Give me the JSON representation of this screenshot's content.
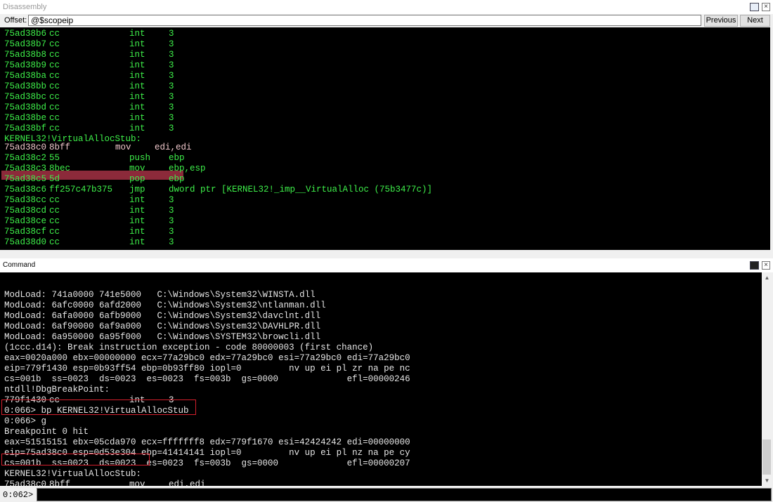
{
  "disassembly": {
    "title": "Disassembly",
    "offset_label": "Offset:",
    "offset_value": "@$scopeip",
    "previous_label": "Previous",
    "next_label": "Next",
    "lines": [
      {
        "addr": "75ad38b6",
        "bytes": "cc",
        "mnemonic": "int",
        "operands": "3"
      },
      {
        "addr": "75ad38b7",
        "bytes": "cc",
        "mnemonic": "int",
        "operands": "3"
      },
      {
        "addr": "75ad38b8",
        "bytes": "cc",
        "mnemonic": "int",
        "operands": "3"
      },
      {
        "addr": "75ad38b9",
        "bytes": "cc",
        "mnemonic": "int",
        "operands": "3"
      },
      {
        "addr": "75ad38ba",
        "bytes": "cc",
        "mnemonic": "int",
        "operands": "3"
      },
      {
        "addr": "75ad38bb",
        "bytes": "cc",
        "mnemonic": "int",
        "operands": "3"
      },
      {
        "addr": "75ad38bc",
        "bytes": "cc",
        "mnemonic": "int",
        "operands": "3"
      },
      {
        "addr": "75ad38bd",
        "bytes": "cc",
        "mnemonic": "int",
        "operands": "3"
      },
      {
        "addr": "75ad38be",
        "bytes": "cc",
        "mnemonic": "int",
        "operands": "3"
      },
      {
        "addr": "75ad38bf",
        "bytes": "cc",
        "mnemonic": "int",
        "operands": "3"
      }
    ],
    "symbol_label": "KERNEL32!VirtualAllocStub:",
    "current_line": {
      "addr": "75ad38c0",
      "bytes": "8bff",
      "mnemonic": "mov",
      "operands": "edi,edi"
    },
    "lines_after": [
      {
        "addr": "75ad38c2",
        "bytes": "55",
        "mnemonic": "push",
        "operands": "ebp"
      },
      {
        "addr": "75ad38c3",
        "bytes": "8bec",
        "mnemonic": "mov",
        "operands": "ebp,esp"
      },
      {
        "addr": "75ad38c5",
        "bytes": "5d",
        "mnemonic": "pop",
        "operands": "ebp"
      },
      {
        "addr": "75ad38c6",
        "bytes": "ff257c47b375",
        "mnemonic": "jmp",
        "operands": "dword ptr [KERNEL32!_imp__VirtualAlloc (75b3477c)]"
      },
      {
        "addr": "75ad38cc",
        "bytes": "cc",
        "mnemonic": "int",
        "operands": "3"
      },
      {
        "addr": "75ad38cd",
        "bytes": "cc",
        "mnemonic": "int",
        "operands": "3"
      },
      {
        "addr": "75ad38ce",
        "bytes": "cc",
        "mnemonic": "int",
        "operands": "3"
      },
      {
        "addr": "75ad38cf",
        "bytes": "cc",
        "mnemonic": "int",
        "operands": "3"
      },
      {
        "addr": "75ad38d0",
        "bytes": "cc",
        "mnemonic": "int",
        "operands": "3"
      }
    ]
  },
  "command": {
    "title": "Command",
    "lines": [
      "ModLoad: 741a0000 741e5000   C:\\Windows\\System32\\WINSTA.dll",
      "ModLoad: 6afc0000 6afd2000   C:\\Windows\\System32\\ntlanman.dll",
      "ModLoad: 6afa0000 6afb9000   C:\\Windows\\System32\\davclnt.dll",
      "ModLoad: 6af90000 6af9a000   C:\\Windows\\System32\\DAVHLPR.dll",
      "ModLoad: 6a950000 6a95f000   C:\\Windows\\SYSTEM32\\browcli.dll",
      "(1ccc.d14): Break instruction exception - code 80000003 (first chance)",
      "eax=0020a000 ebx=00000000 ecx=77a29bc0 edx=77a29bc0 esi=77a29bc0 edi=77a29bc0",
      "eip=779f1430 esp=0b93ff54 ebp=0b93ff80 iopl=0         nv up ei pl zr na pe nc",
      "cs=001b  ss=0023  ds=0023  es=0023  fs=003b  gs=0000             efl=00000246",
      "ntdll!DbgBreakPoint:"
    ],
    "break_line": {
      "addr": "779f1430",
      "bytes": "cc",
      "mnemonic": "int",
      "operands": "3"
    },
    "lines2": [
      "0:066> bp KERNEL32!VirtualAllocStub",
      "0:066> g",
      "Breakpoint 0 hit",
      "eax=51515151 ebx=05cda970 ecx=fffffff8 edx=779f1670 esi=42424242 edi=00000000",
      "eip=75ad38c0 esp=0d53e304 ebp=41414141 iopl=0         nv up ei pl nz na pe cy",
      "cs=001b  ss=0023  ds=0023  es=0023  fs=003b  gs=0000             efl=00000207",
      "KERNEL32!VirtualAllocStub:"
    ],
    "final_line": {
      "addr": "75ad38c0",
      "bytes": "8bff",
      "mnemonic": "mov",
      "operands": "edi,edi"
    },
    "prompt_label": "0:062>",
    "prompt_value": ""
  },
  "colors": {
    "disasm_text": "#3ef04a",
    "highlight": "#8c2a3a",
    "command_text": "#e6e6e6",
    "box_outline": "#d41f2c"
  }
}
